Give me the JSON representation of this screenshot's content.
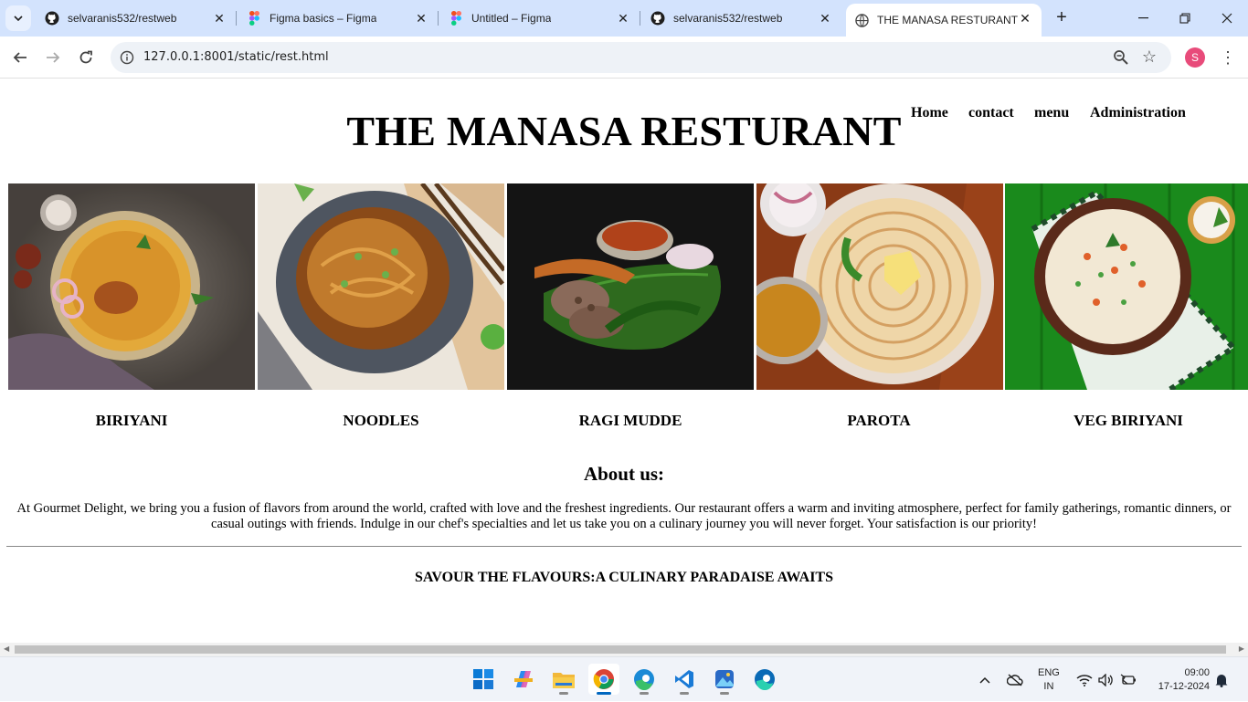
{
  "browser": {
    "tabs": [
      {
        "label": "selvaranis532/restweb",
        "icon": "github-icon"
      },
      {
        "label": "Figma basics – Figma",
        "icon": "figma-icon"
      },
      {
        "label": "Untitled – Figma",
        "icon": "figma-icon"
      },
      {
        "label": "selvaranis532/restweb",
        "icon": "github-icon"
      },
      {
        "label": "THE MANASA RESTURANT",
        "icon": "globe-icon",
        "active": true
      }
    ],
    "url": "127.0.0.1:8001/static/rest.html",
    "profile_initial": "S"
  },
  "site": {
    "title": "THE MANASA RESTURANT",
    "nav": [
      "Home",
      "contact",
      "menu",
      "Administration"
    ],
    "foods": [
      {
        "name": "BIRIYANI",
        "image": "biryani-photo"
      },
      {
        "name": "NOODLES",
        "image": "noodles-photo"
      },
      {
        "name": "RAGI MUDDE",
        "image": "ragi-mudde-photo"
      },
      {
        "name": "PAROTA",
        "image": "parota-photo"
      },
      {
        "name": "VEG BIRIYANI",
        "image": "veg-biryani-photo"
      }
    ],
    "about_heading": "About us:",
    "about_text": "At Gourmet Delight, we bring you a fusion of flavors from around the world, crafted with love and the freshest ingredients. Our restaurant offers a warm and inviting atmosphere, perfect for family gatherings, romantic dinners, or casual outings with friends. Indulge in our chef's specialties and let us take you on a culinary journey you will never forget. Your satisfaction is our priority!",
    "slogan": "SAVOUR THE FLAVOURS:A CULINARY PARADAISE AWAITS"
  },
  "taskbar": {
    "apps": [
      "windows-start-icon",
      "copilot-icon",
      "file-explorer-icon",
      "chrome-icon",
      "edge-icon",
      "vscode-icon",
      "photos-icon",
      "edge-beta-icon"
    ],
    "lang_top": "ENG",
    "lang_bottom": "IN",
    "time": "09:00",
    "date": "17-12-2024"
  },
  "colors": {
    "tabstrip": "#d3e3fd",
    "accent": "#0067c0",
    "profile": "#e84b7a"
  }
}
